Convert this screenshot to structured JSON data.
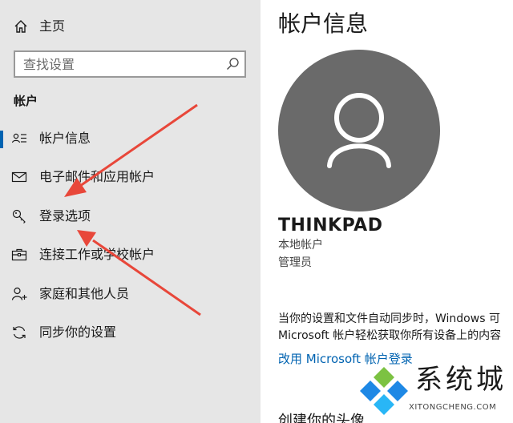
{
  "sidebar": {
    "home_label": "主页",
    "search_placeholder": "查找设置",
    "section_title": "帐户",
    "items": [
      {
        "label": "帐户信息",
        "icon": "account-info-icon",
        "selected": true
      },
      {
        "label": "电子邮件和应用帐户",
        "icon": "mail-icon",
        "selected": false
      },
      {
        "label": "登录选项",
        "icon": "key-icon",
        "selected": false
      },
      {
        "label": "连接工作或学校帐户",
        "icon": "briefcase-icon",
        "selected": false
      },
      {
        "label": "家庭和其他人员",
        "icon": "add-person-icon",
        "selected": false
      },
      {
        "label": "同步你的设置",
        "icon": "sync-icon",
        "selected": false
      }
    ]
  },
  "main": {
    "title": "帐户信息",
    "account_name": "THINKPAD",
    "account_type": "本地帐户",
    "account_role": "管理员",
    "sync_text_line1": "当你的设置和文件自动同步时，Windows 可",
    "sync_text_line2": "Microsoft 帐户轻松获取你所有设备上的内容",
    "ms_link": "改用 Microsoft 帐户登录",
    "cut_heading": "创建你的头像"
  },
  "watermark": {
    "title": "系统城",
    "subtitle": "XITONGCHENG.COM"
  },
  "colors": {
    "sidebar_bg": "#e6e6e6",
    "accent": "#0063b1",
    "avatar_bg": "#6a6a6a",
    "arrow": "#e8473a"
  }
}
